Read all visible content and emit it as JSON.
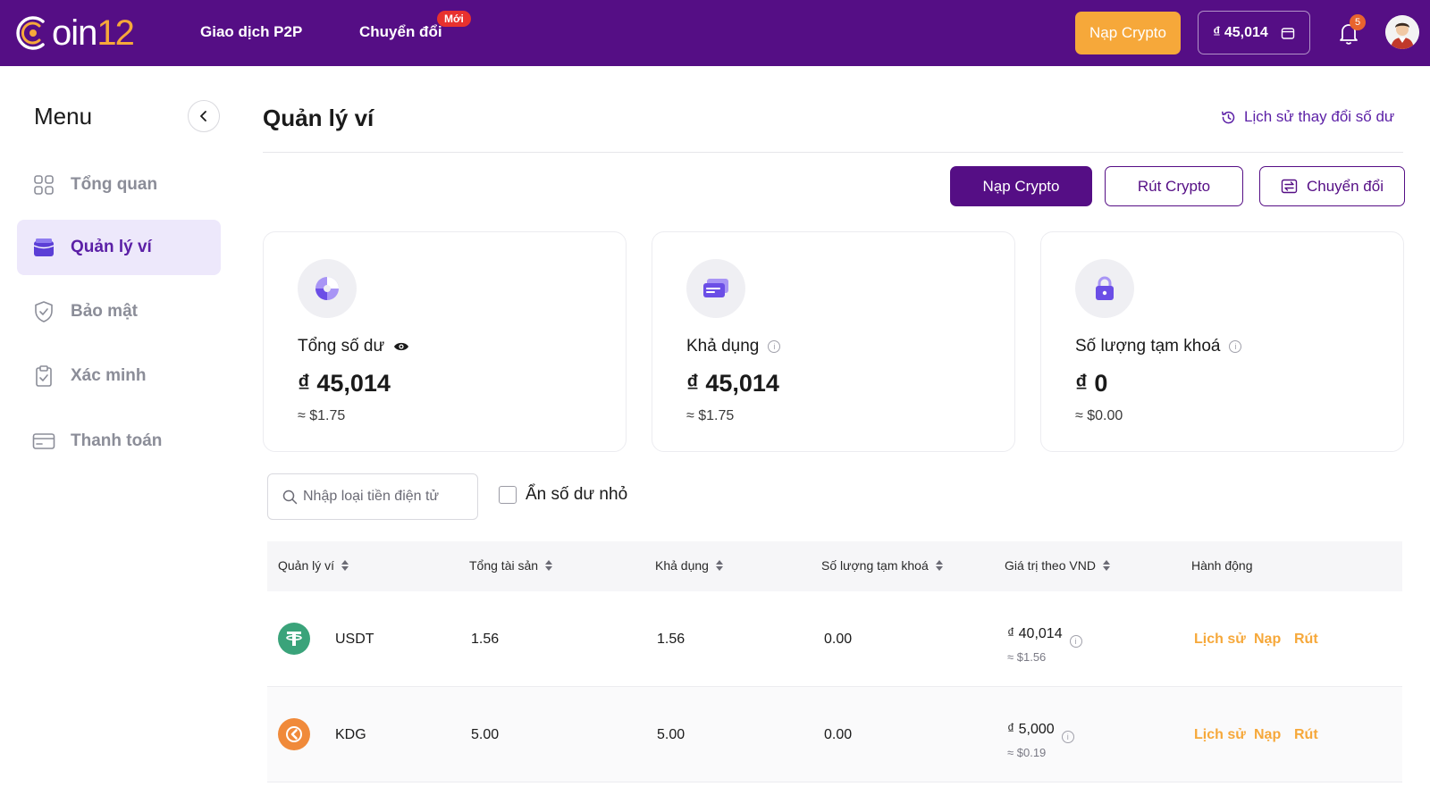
{
  "header": {
    "logo_text": "oin",
    "logo_num": "12",
    "nav": [
      {
        "label": "Giao dịch P2P"
      },
      {
        "label": "Chuyển đổi",
        "badge": "Mới"
      }
    ],
    "deposit_label": "Nạp Crypto",
    "balance": "₫ 45,014",
    "notification_count": "5",
    "colors": {
      "bar": "#550e85",
      "accent": "#f6a83a",
      "badge": "#e8312e"
    }
  },
  "sidebar": {
    "title": "Menu",
    "items": [
      {
        "label": "Tổng quan",
        "icon": "grid-icon",
        "active": false
      },
      {
        "label": "Quản lý ví",
        "icon": "wallet-icon",
        "active": true
      },
      {
        "label": "Bảo mật",
        "icon": "shield-icon",
        "active": false
      },
      {
        "label": "Xác minh",
        "icon": "clipboard-icon",
        "active": false
      },
      {
        "label": "Thanh toán",
        "icon": "card-icon",
        "active": false
      }
    ]
  },
  "main": {
    "title": "Quản lý ví",
    "history_link": "Lịch sử thay đổi số dư",
    "actions": {
      "deposit": "Nạp Crypto",
      "withdraw": "Rút Crypto",
      "convert": "Chuyển đổi"
    },
    "cards": [
      {
        "label": "Tổng số dư",
        "value": "₫ 45,014",
        "approx": "≈  $1.75",
        "icon": "pie-chart-icon",
        "label_icon": "eye-icon"
      },
      {
        "label": "Khả dụng",
        "value": "₫ 45,014",
        "approx": "≈  $1.75",
        "icon": "credit-card-icon",
        "label_icon": "info-icon"
      },
      {
        "label": "Số lượng tạm khoá",
        "value": "₫ 0",
        "approx": "≈  $0.00",
        "icon": "lock-icon",
        "label_icon": "info-icon"
      }
    ],
    "search": {
      "placeholder": "Nhập loại tiền điện tử",
      "value": ""
    },
    "hide_small_label": "Ẩn số dư nhỏ",
    "hide_small_checked": false,
    "table": {
      "columns": [
        "Quản lý ví",
        "Tổng tài sản",
        "Khả dụng",
        "Số lượng tạm khoá",
        "Giá trị theo VND",
        "Hành động"
      ],
      "rows": [
        {
          "coin": "USDT",
          "icon": "usdt-icon",
          "total": "1.56",
          "available": "1.56",
          "locked": "0.00",
          "vnd": "₫ 40,014",
          "usd": "≈ $1.56",
          "actions": [
            "Lịch sử",
            "Nạp",
            "Rút"
          ]
        },
        {
          "coin": "KDG",
          "icon": "kdg-icon",
          "total": "5.00",
          "available": "5.00",
          "locked": "0.00",
          "vnd": "₫ 5,000",
          "usd": "≈ $0.19",
          "actions": [
            "Lịch sử",
            "Nạp",
            "Rút"
          ]
        }
      ]
    }
  }
}
